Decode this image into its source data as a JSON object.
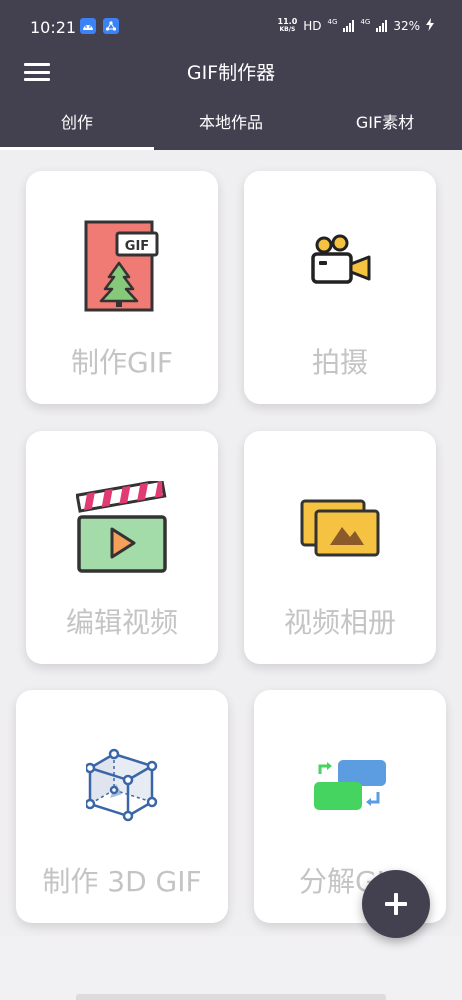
{
  "status_bar": {
    "time": "10:21",
    "net_speed_value": "11.0",
    "net_speed_unit": "KB/S",
    "hd_label": "HD",
    "network_1": "4G",
    "network_2": "4G",
    "battery": "32%",
    "icons": [
      "android-notification-icon",
      "share-notification-icon",
      "signal-icon",
      "signal-icon",
      "charging-icon"
    ]
  },
  "app_bar": {
    "title": "GIF制作器",
    "menu_icon": "hamburger-menu-icon"
  },
  "tabs": [
    {
      "label": "创作",
      "active": true
    },
    {
      "label": "本地作品",
      "active": false
    },
    {
      "label": "GIF素材",
      "active": false
    }
  ],
  "cards": [
    {
      "label": "制作GIF",
      "icon": "gif-document-icon"
    },
    {
      "label": "拍摄",
      "icon": "video-camera-icon"
    },
    {
      "label": "编辑视频",
      "icon": "clapperboard-icon"
    },
    {
      "label": "视频相册",
      "icon": "photo-album-icon"
    },
    {
      "label": "制作 3D GIF",
      "icon": "3d-cube-icon"
    },
    {
      "label": "分解GIF",
      "icon": "split-frames-icon"
    }
  ],
  "fab": {
    "icon": "plus-icon"
  },
  "colors": {
    "primary": "#434050",
    "background": "#efeef0",
    "card": "#ffffff",
    "label": "#c4c4c4"
  }
}
